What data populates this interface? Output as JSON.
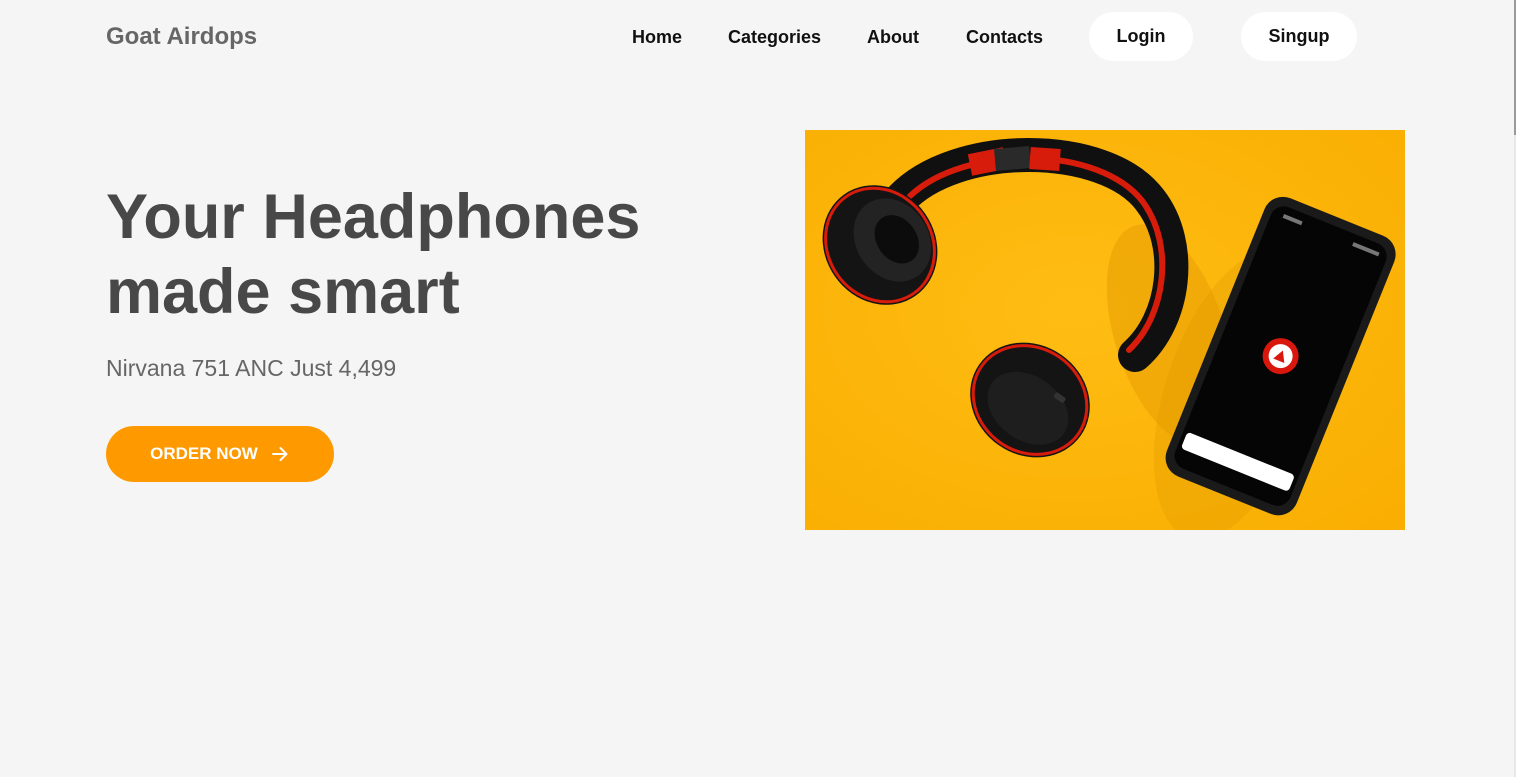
{
  "header": {
    "brand": "Goat Airdops",
    "nav": [
      {
        "label": "Home"
      },
      {
        "label": "Categories"
      },
      {
        "label": "About"
      },
      {
        "label": "Contacts"
      }
    ],
    "login_label": "Login",
    "signup_label": "Singup"
  },
  "hero": {
    "title_line1": "Your Headphones",
    "title_line2": "made smart",
    "subtitle": "Nirvana 751 ANC Just 4,499",
    "cta_label": "ORDER NOW",
    "cta_icon": "arrow-right-icon"
  },
  "product_image": {
    "subject": "headphones-and-phone-photo"
  },
  "colors": {
    "background": "#f5f5f5",
    "accent": "#ff9900",
    "image_background": "#ffb400",
    "title_text": "#484848",
    "muted_text": "#666666"
  }
}
